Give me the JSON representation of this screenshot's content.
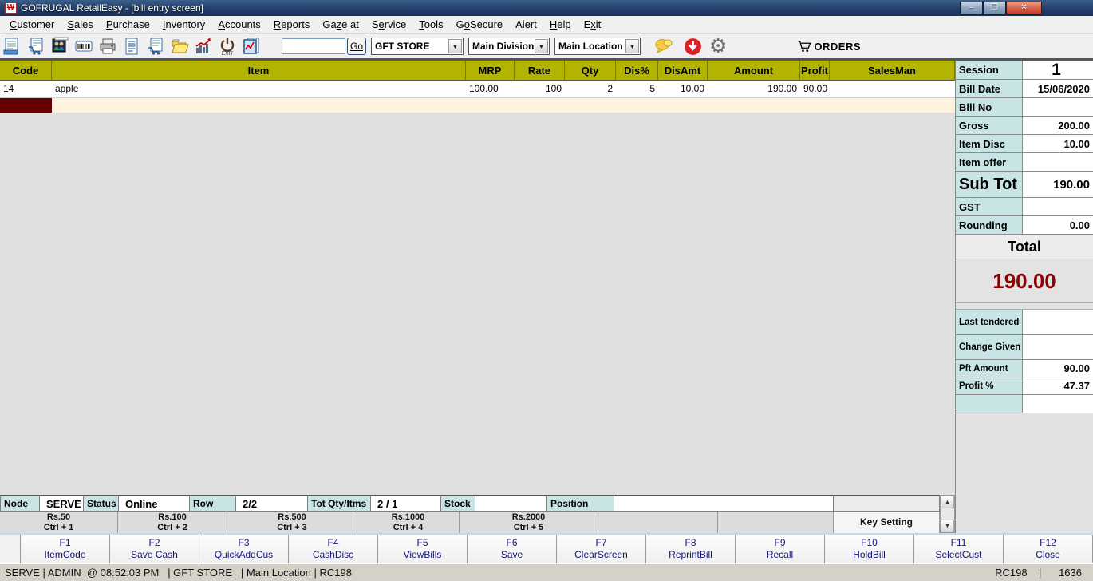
{
  "window": {
    "title": "GOFRUGAL RetailEasy - [bill entry screen]",
    "controls": {
      "minimize": "–",
      "restore": "❐",
      "close": "✕"
    }
  },
  "menu": {
    "items": [
      {
        "label": "Customer",
        "u": 0
      },
      {
        "label": "Sales",
        "u": 0
      },
      {
        "label": "Purchase",
        "u": 0
      },
      {
        "label": "Inventory",
        "u": 0
      },
      {
        "label": "Accounts",
        "u": 0
      },
      {
        "label": "Reports",
        "u": 0
      },
      {
        "label": "Gaze at",
        "u": 2
      },
      {
        "label": "Service",
        "u": 1
      },
      {
        "label": "Tools",
        "u": 0
      },
      {
        "label": "GoSecure",
        "u": 1
      },
      {
        "label": "Alert",
        "u": -1
      },
      {
        "label": "Help",
        "u": 0
      },
      {
        "label": "Exit",
        "u": 1
      }
    ]
  },
  "toolbar": {
    "icon_names": [
      "new-bill-icon",
      "sales-cart-icon",
      "customers-icon",
      "barcode-icon",
      "printer-icon",
      "bill-list-icon",
      "cart-doc-icon",
      "open-folder-icon",
      "sales-chart-icon",
      "exit-power-icon",
      "chart-report-icon"
    ],
    "search": {
      "value": "",
      "go_label": "Go"
    },
    "store_dropdown": "GFT STORE",
    "division_dropdown": "Main Division",
    "location_dropdown": "Main Location",
    "gear_glyph": "⚙",
    "orders_label": "ORDERS"
  },
  "grid": {
    "columns": [
      "Code",
      "Item",
      "MRP",
      "Rate",
      "Qty",
      "Dis%",
      "DisAmt",
      "Amount",
      "Profit",
      "SalesMan"
    ],
    "rows": [
      [
        "14",
        "apple",
        "100.00",
        "100",
        "2",
        "5",
        "10.00",
        "190.00",
        "90.00",
        ""
      ]
    ]
  },
  "summary": {
    "rows": [
      {
        "label": "Session",
        "value": "1"
      },
      {
        "label": "Bill Date",
        "value": "15/06/2020"
      },
      {
        "label": "Bill No",
        "value": ""
      },
      {
        "label": "Gross",
        "value": "200.00"
      },
      {
        "label": "Item Disc",
        "value": "10.00"
      },
      {
        "label": "Item offer",
        "value": ""
      },
      {
        "label": "Sub Tot",
        "value": "190.00"
      },
      {
        "label": "GST",
        "value": ""
      },
      {
        "label": "Rounding",
        "value": "0.00"
      }
    ],
    "total_label": "Total",
    "total_value": "190.00",
    "rows2": [
      {
        "label": "Last tendered",
        "value": ""
      },
      {
        "label": "Change Given",
        "value": ""
      },
      {
        "label": "Pft Amount",
        "value": "90.00"
      },
      {
        "label": "Profit %",
        "value": "47.37"
      },
      {
        "label": "",
        "value": ""
      }
    ]
  },
  "statusline": {
    "cells": [
      {
        "label": "Node",
        "value": "SERVE"
      },
      {
        "label": "Status",
        "value": "Online"
      },
      {
        "label": "Row",
        "value": "2/2"
      },
      {
        "label": "Tot Qty/Itms",
        "value": "2 / 1"
      },
      {
        "label": "Stock",
        "value": ""
      },
      {
        "label": "Position",
        "value": ""
      }
    ]
  },
  "shortcuts": {
    "money": [
      {
        "amount": "Rs.50",
        "key": "Ctrl + 1"
      },
      {
        "amount": "Rs.100",
        "key": "Ctrl + 2"
      },
      {
        "amount": "Rs.500",
        "key": "Ctrl + 3"
      },
      {
        "amount": "Rs.1000",
        "key": "Ctrl + 4"
      },
      {
        "amount": "Rs.2000",
        "key": "Ctrl + 5"
      }
    ],
    "key_setting_label": "Key Setting"
  },
  "fkeys": [
    {
      "key": "F1",
      "label": "ItemCode"
    },
    {
      "key": "F2",
      "label": "Save  Cash"
    },
    {
      "key": "F3",
      "label": "QuickAddCus"
    },
    {
      "key": "F4",
      "label": "CashDisc"
    },
    {
      "key": "F5",
      "label": "ViewBills"
    },
    {
      "key": "F6",
      "label": "Save"
    },
    {
      "key": "F7",
      "label": "ClearScreen"
    },
    {
      "key": "F8",
      "label": "ReprintBill"
    },
    {
      "key": "F9",
      "label": "Recall"
    },
    {
      "key": "F10",
      "label": "HoldBill"
    },
    {
      "key": "F11",
      "label": "SelectCust"
    },
    {
      "key": "F12",
      "label": "Close"
    }
  ],
  "statusbar": {
    "left": "SERVE | ADMIN  @ 08:52:03 PM   | GFT STORE   | Main Location | RC198",
    "right": "RC198    |      1636"
  }
}
